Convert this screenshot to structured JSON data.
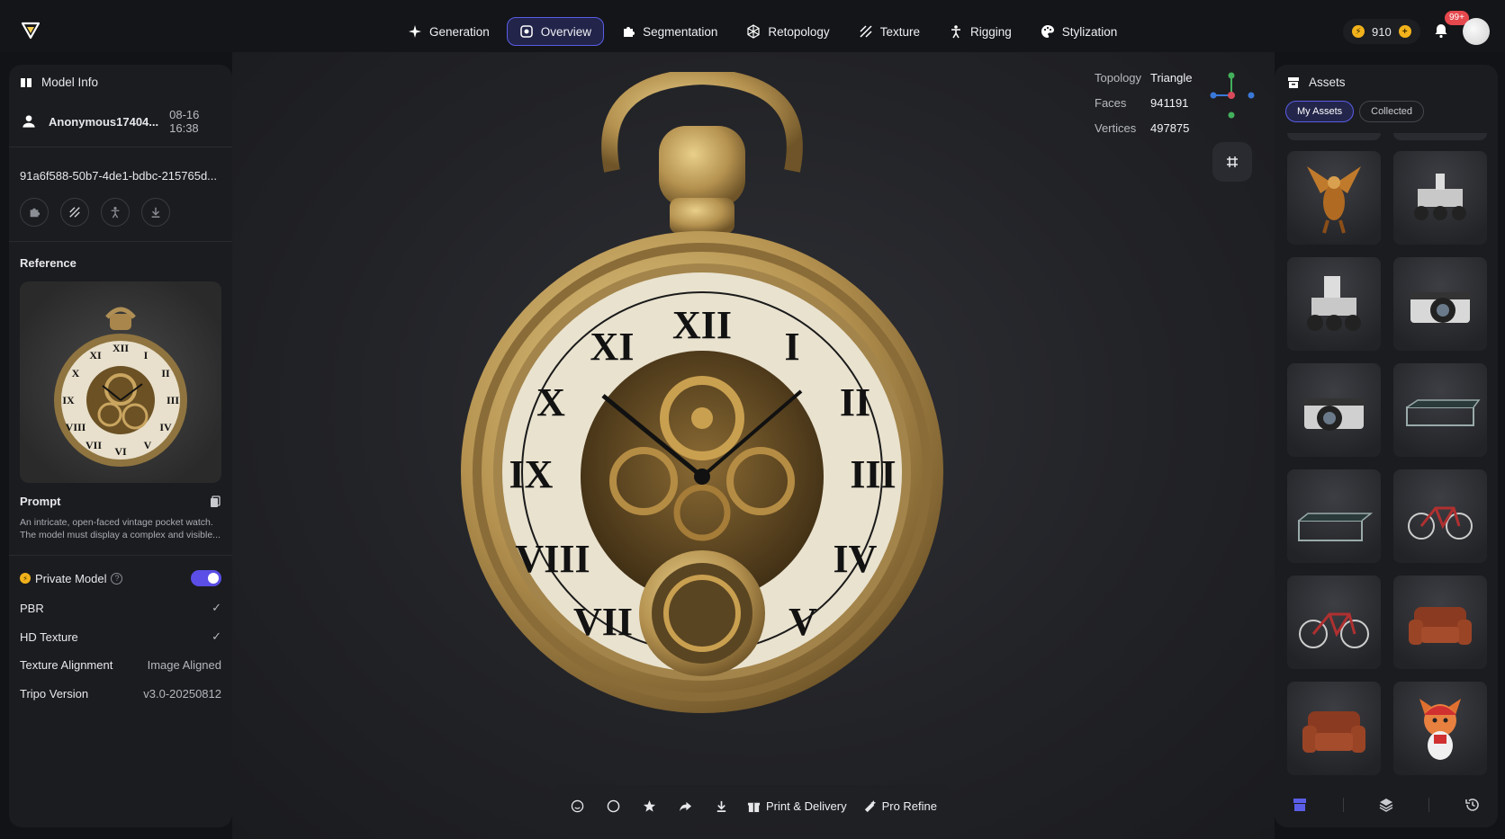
{
  "nav": {
    "items": [
      {
        "label": "Generation",
        "icon": "sparkle-icon"
      },
      {
        "label": "Overview",
        "icon": "overview-icon",
        "active": true
      },
      {
        "label": "Segmentation",
        "icon": "puzzle-icon"
      },
      {
        "label": "Retopology",
        "icon": "mesh-icon"
      },
      {
        "label": "Texture",
        "icon": "texture-icon"
      },
      {
        "label": "Rigging",
        "icon": "rigging-icon"
      },
      {
        "label": "Stylization",
        "icon": "palette-icon"
      }
    ],
    "credits": "910",
    "notifications": "99+"
  },
  "left": {
    "title": "Model Info",
    "username": "Anonymous17404...",
    "date": "08-16 16:38",
    "model_id": "91a6f588-50b7-4de1-bdbc-215765d...",
    "reference_label": "Reference",
    "prompt_label": "Prompt",
    "prompt_text": "An intricate, open-faced vintage pocket watch. The model must display a complex and visible...",
    "private_model_label": "Private Model",
    "private_model_on": true,
    "settings": [
      {
        "label": "PBR",
        "value": "✓"
      },
      {
        "label": "HD Texture",
        "value": "✓"
      },
      {
        "label": "Texture Alignment",
        "value": "Image Aligned"
      },
      {
        "label": "Tripo Version",
        "value": "v3.0-20250812"
      }
    ]
  },
  "viewport": {
    "stats": [
      {
        "key": "Topology",
        "value": "Triangle"
      },
      {
        "key": "Faces",
        "value": "941191"
      },
      {
        "key": "Vertices",
        "value": "497875"
      }
    ]
  },
  "bottom_bar": {
    "print_label": "Print & Delivery",
    "refine_label": "Pro Refine"
  },
  "right": {
    "title": "Assets",
    "tabs": [
      "My Assets",
      "Collected"
    ],
    "assets": [
      "griffin",
      "rover",
      "rover",
      "camera",
      "camera",
      "glass-table",
      "glass-table",
      "bicycle",
      "bicycle",
      "armchair",
      "armchair",
      "fox-figure"
    ]
  },
  "colors": {
    "accent": "#5a5ee6",
    "gold": "#c9a560",
    "coin": "#f2b21b",
    "badge": "#e5484d"
  }
}
